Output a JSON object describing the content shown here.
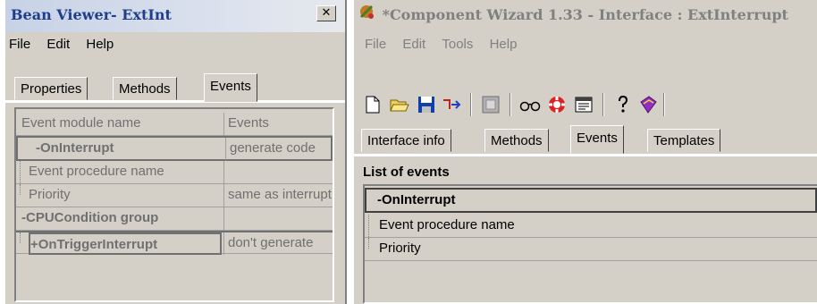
{
  "left_window": {
    "title": "Bean Viewer- ExtInt",
    "close_glyph": "✕",
    "menu": [
      "File",
      "Edit",
      "Help"
    ],
    "tabs": [
      "Properties",
      "Methods",
      "Events"
    ],
    "active_tab": "Events",
    "grid": {
      "headers": [
        "Event module name",
        "Events"
      ],
      "rows": [
        {
          "name": "-OnInterrupt",
          "value": "generate code"
        },
        {
          "name": "Event procedure name",
          "value": ""
        },
        {
          "name": "Priority",
          "value": "same as interrupt"
        },
        {
          "name": "-CPUCondition group",
          "value": ""
        },
        {
          "name": "+OnTriggerInterrupt",
          "value": "don't generate"
        }
      ]
    }
  },
  "right_window": {
    "title": "*Component Wizard 1.33 - Interface : ExtInterrupt",
    "menu": [
      "File",
      "Edit",
      "Tools",
      "Help"
    ],
    "toolbar_icons": [
      "new-file-icon",
      "open-folder-icon",
      "save-disk-icon",
      "arrow-tool-icon",
      "gray-box-icon",
      "glasses-icon",
      "lifebuoy-icon",
      "window-icon",
      "help-question-icon",
      "book-icon"
    ],
    "tabs": [
      "Interface info",
      "Methods",
      "Events",
      "Templates"
    ],
    "active_tab": "Events",
    "list_label": "List of events",
    "list": {
      "group": "-OnInterrupt",
      "items": [
        "Event procedure name",
        "Priority"
      ]
    }
  }
}
